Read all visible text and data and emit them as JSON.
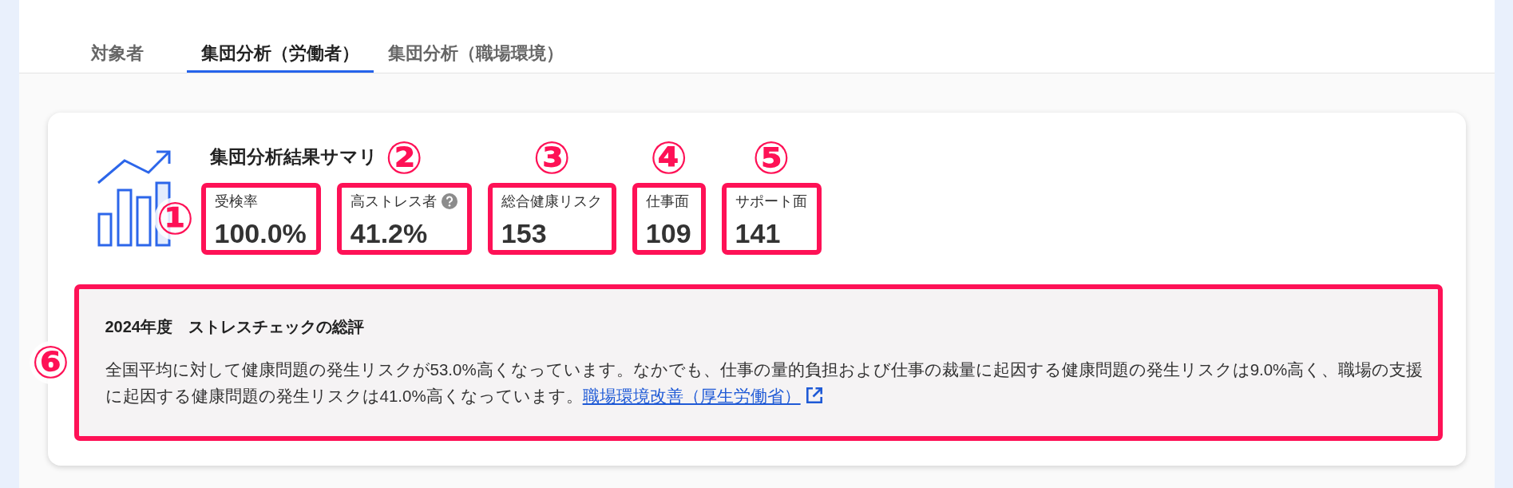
{
  "tabs": [
    {
      "label": "対象者",
      "selected": false
    },
    {
      "label": "集団分析（労働者）",
      "selected": true
    },
    {
      "label": "集団分析（職場環境）",
      "selected": false
    }
  ],
  "summary": {
    "title": "集団分析結果サマリ",
    "metrics": [
      {
        "label": "受検率",
        "value": "100.0%",
        "help": false,
        "callout": {
          "number": "①",
          "kind": "side"
        }
      },
      {
        "label": "高ストレス者",
        "value": "41.2%",
        "help": true,
        "callout": {
          "number": "②",
          "kind": "above"
        }
      },
      {
        "label": "総合健康リスク",
        "value": "153",
        "help": false,
        "callout": {
          "number": "③",
          "kind": "above"
        }
      },
      {
        "label": "仕事面",
        "value": "109",
        "help": false,
        "callout": {
          "number": "④",
          "kind": "above"
        }
      },
      {
        "label": "サポート面",
        "value": "141",
        "help": false,
        "callout": {
          "number": "⑤",
          "kind": "above"
        }
      }
    ]
  },
  "commentary": {
    "title": "2024年度　ストレスチェックの総評",
    "text": "全国平均に対して健康問題の発生リスクが53.0%高くなっています。なかでも、仕事の量的負担および仕事の裁量に起因する健康問題の発生リスクは9.0%高く、職場の支援に起因する健康問題の発生リスクは41.0%高くなっています。",
    "link": {
      "label": "職場環境改善（厚生労働省）",
      "external": true
    },
    "callout": {
      "number": "⑥",
      "kind": "side"
    }
  }
}
